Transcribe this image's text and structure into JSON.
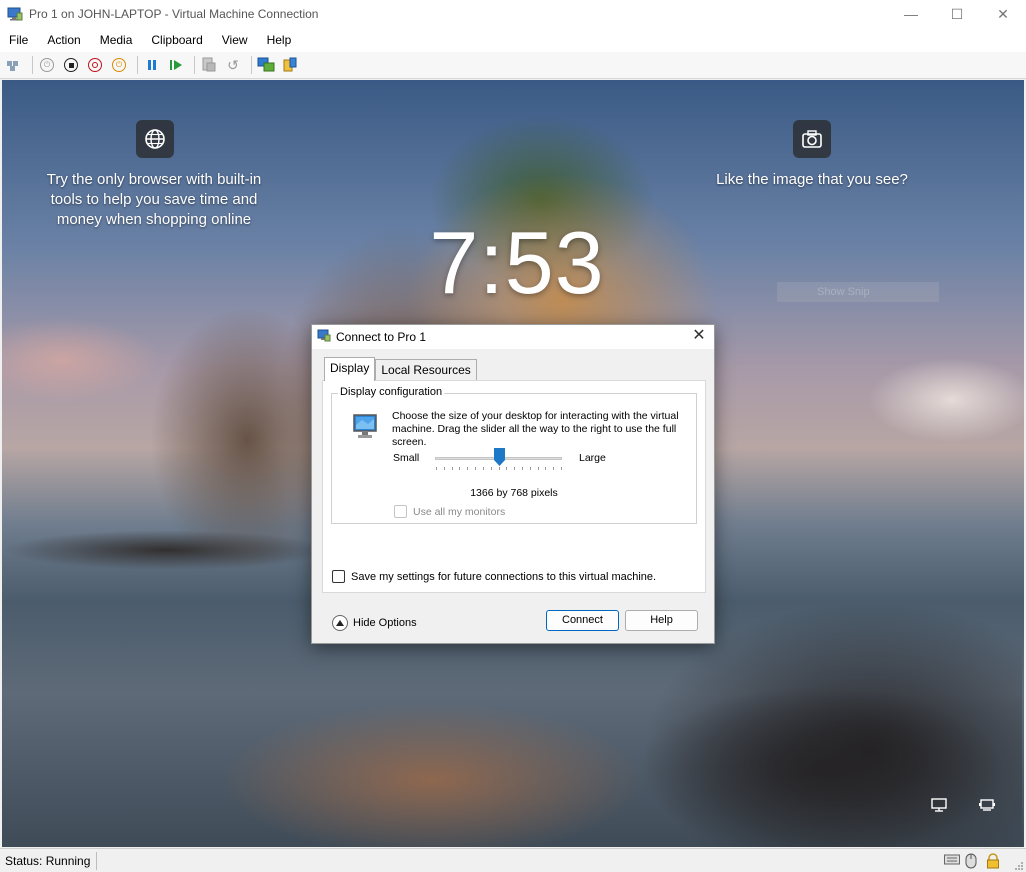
{
  "window": {
    "title": "Pro 1 on JOHN-LAPTOP - Virtual Machine Connection",
    "controls": {
      "minimize": "—",
      "maximize": "☐",
      "close": "✕"
    }
  },
  "menu": {
    "items": [
      {
        "label": "File"
      },
      {
        "label": "Action"
      },
      {
        "label": "Media"
      },
      {
        "label": "Clipboard"
      },
      {
        "label": "View"
      },
      {
        "label": "Help"
      }
    ]
  },
  "toolbar": {
    "buttons": [
      "ctrl-alt-del-icon",
      "start-icon",
      "turn-off-icon",
      "shut-down-icon",
      "save-icon",
      "pause-icon",
      "resume-icon",
      "checkpoint-icon",
      "revert-icon",
      "enhanced-session-icon",
      "share-icon"
    ]
  },
  "lockscreen": {
    "left_tip": "Try the only browser with built-in tools to help you save time and money when shopping online",
    "right_tip": "Like the image that you see?",
    "time": "7:53",
    "faded_button": "Show Snip"
  },
  "dialog": {
    "title": "Connect to Pro 1",
    "tabs": [
      {
        "label": "Display",
        "active": true
      },
      {
        "label": "Local Resources",
        "active": false
      }
    ],
    "display_group_label": "Display configuration",
    "description": "Choose the size of your desktop for interacting with the virtual machine. Drag the slider all the way to the right to use the full screen.",
    "slider": {
      "min_label": "Small",
      "max_label": "Large",
      "position_fraction": 0.5
    },
    "resolution": "1366 by 768 pixels",
    "use_all_monitors": {
      "label": "Use all my monitors",
      "checked": false,
      "enabled": false
    },
    "save_settings": {
      "label": "Save my settings for future connections to this virtual machine.",
      "checked": false
    },
    "hide_options": "Hide Options",
    "connect_button": "Connect",
    "help_button": "Help"
  },
  "statusbar": {
    "status": "Status: Running"
  },
  "colors": {
    "accent": "#0067c0",
    "slider_thumb": "#1e78c8"
  }
}
